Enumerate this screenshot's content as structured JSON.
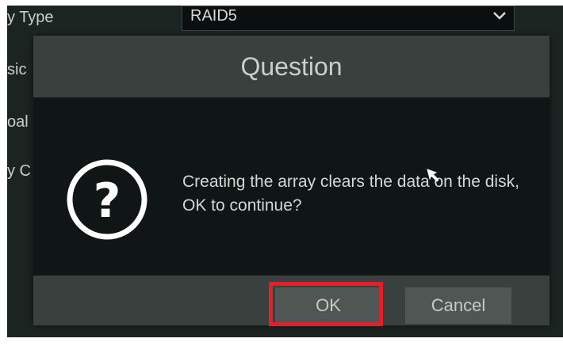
{
  "background": {
    "labels": [
      "y Type",
      "sic",
      "oal",
      "y C"
    ],
    "select_value": "RAID5",
    "chevron_icon": "chevron-down-icon"
  },
  "dialog": {
    "title": "Question",
    "icon": "question-icon",
    "message": "Creating the array clears the data on the disk, OK to continue?",
    "ok_label": "OK",
    "cancel_label": "Cancel",
    "highlight_color": "#e0202a"
  },
  "cursor": "mouse-cursor-icon"
}
